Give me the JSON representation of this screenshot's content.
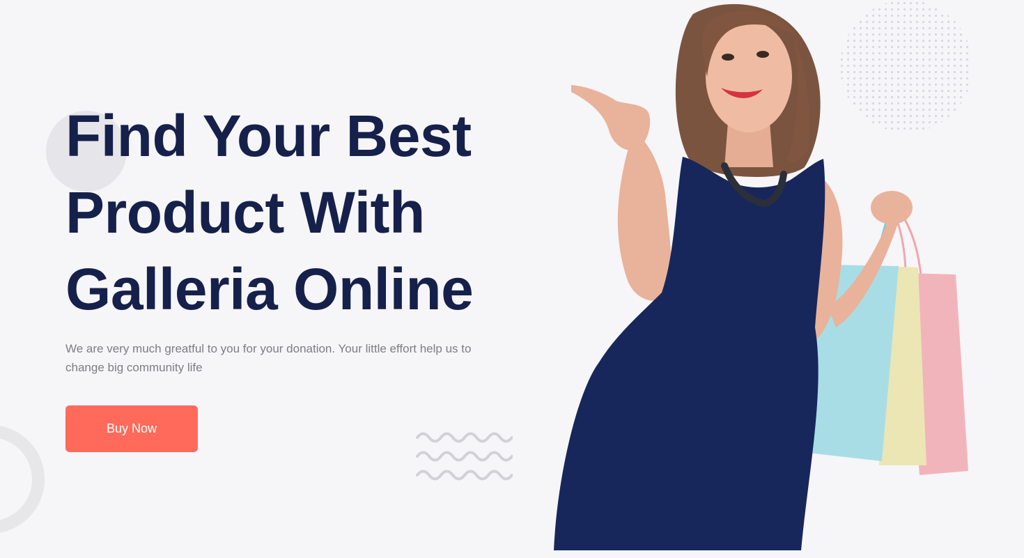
{
  "hero": {
    "headline": "Find Your Best Product With Galleria Online",
    "description": "We are very much greatful to you for your donation. Your little effort help us to change big community life",
    "cta_label": "Buy Now"
  },
  "colors": {
    "background": "#f6f5f8",
    "headline": "#15214a",
    "description": "#7d7d85",
    "cta": "#ff6a5a",
    "dress": "#17275c",
    "bag_blue": "#a9dde6",
    "bag_yellow": "#ebe6b4",
    "bag_pink": "#f2b4bb"
  },
  "icons": {
    "dots_pattern": "dots-pattern-icon",
    "waves": "waves-icon"
  }
}
